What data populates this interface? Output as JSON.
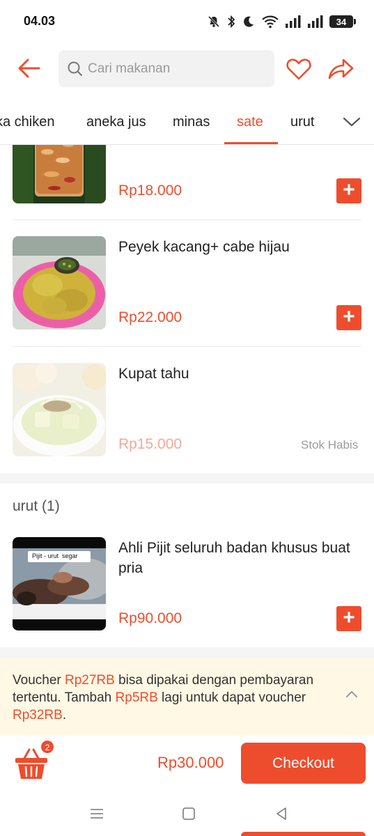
{
  "status_bar": {
    "time": "04.03",
    "battery": "34",
    "icons": [
      "mute-icon",
      "bluetooth-icon",
      "moon-icon",
      "wifi-icon",
      "signal-icon",
      "signal-icon",
      "battery-icon"
    ]
  },
  "header": {
    "search_placeholder": "Cari makanan",
    "icons": [
      "back-arrow-icon",
      "search-icon",
      "heart-icon",
      "share-icon"
    ]
  },
  "tabs": {
    "items": [
      "ka chiken",
      "aneka jus",
      "minas",
      "sate",
      "urut"
    ],
    "active": "sate",
    "more_icon": "chevron-down-icon"
  },
  "products": [
    {
      "name": "",
      "price": "Rp18.000",
      "available": true
    },
    {
      "name": "Peyek kacang+ cabe hijau",
      "price": "Rp22.000",
      "available": true
    },
    {
      "name": "Kupat tahu",
      "price": "Rp15.000",
      "available": false,
      "stock_label": "Stok Habis"
    }
  ],
  "section": {
    "title": "urut (1)",
    "products": [
      {
        "name": "Ahli Pijit seluruh badan khusus buat pria",
        "price": "Rp90.000",
        "image_caption": "Pijit - urut  segar"
      }
    ]
  },
  "voucher": {
    "t1": "Voucher ",
    "v1": "Rp27RB",
    "t2": " bisa dipakai dengan pembayaran tertentu. Tambah ",
    "v2": "Rp5RB",
    "t3": " lagi untuk dapat voucher ",
    "v3": "Rp32RB",
    "t4": "."
  },
  "bottom_bar": {
    "cart_count": "2",
    "total": "Rp30.000",
    "checkout_label": "Checkout"
  },
  "colors": {
    "accent": "#ee4d2d",
    "voucher_bg": "#fff8e4"
  }
}
